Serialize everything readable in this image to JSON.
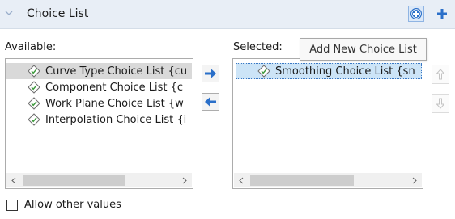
{
  "header": {
    "title": "Choice List",
    "collapse_icon": "chevron-down-icon",
    "add_choice_icon": "circle-plus-icon",
    "add_icon": "plus-icon",
    "accent": "#2a6fc9"
  },
  "labels": {
    "available": "Available:",
    "selected": "Selected:"
  },
  "available": {
    "items": [
      {
        "label": "Curve Type Choice List {cu",
        "icon": "choice-list-icon",
        "state": "selected"
      },
      {
        "label": "Component Choice List {c",
        "icon": "choice-list-icon",
        "state": "normal"
      },
      {
        "label": "Work Plane Choice List {w",
        "icon": "choice-list-icon",
        "state": "normal"
      },
      {
        "label": "Interpolation Choice List {i",
        "icon": "choice-list-icon",
        "state": "normal"
      }
    ]
  },
  "selected": {
    "items": [
      {
        "label": "Smoothing Choice List {sn",
        "icon": "choice-list-icon",
        "state": "selected"
      }
    ]
  },
  "tooltip": {
    "text": "Add New Choice List"
  },
  "checkbox": {
    "label": "Allow other values",
    "checked": false
  },
  "colors": {
    "header_bg": "#e8eef6",
    "selection_gray": "#d9d9d9",
    "selection_blue": "#cce4f7",
    "arrow_blue": "#2a6fc9"
  }
}
